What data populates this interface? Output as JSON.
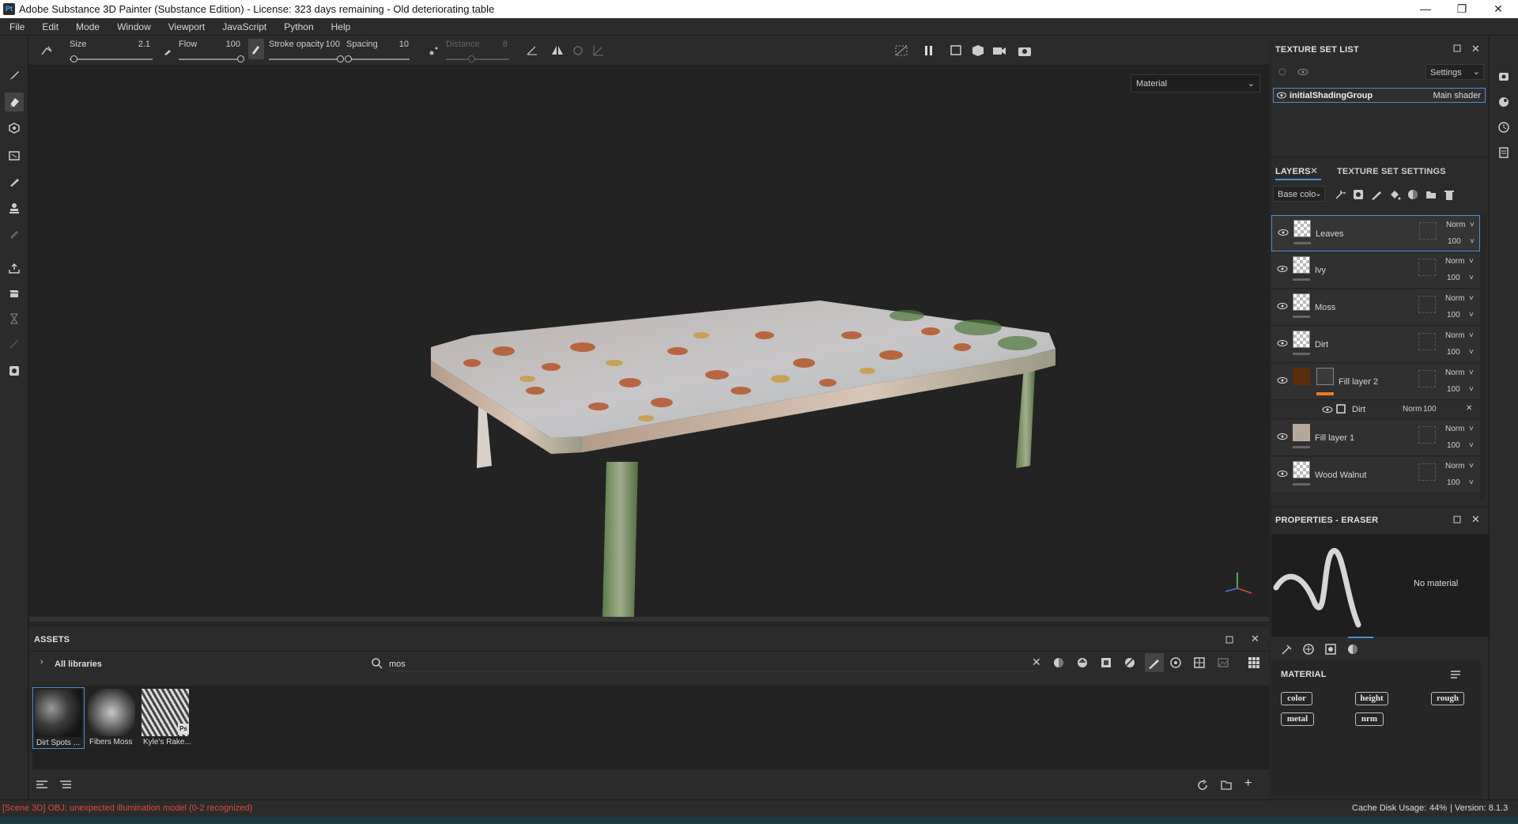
{
  "window": {
    "title": "Adobe Substance 3D Painter (Substance Edition) - License: 323 days remaining - Old deteriorating table",
    "app_icon": "Pt",
    "controls": [
      "minimize",
      "maximize",
      "close"
    ]
  },
  "menu": [
    "File",
    "Edit",
    "Mode",
    "Window",
    "Viewport",
    "JavaScript",
    "Python",
    "Help"
  ],
  "toolbar": {
    "size_label": "Size",
    "size_value": "2.1",
    "flow_label": "Flow",
    "flow_value": "100",
    "stroke_label": "Stroke opacity",
    "stroke_value": "100",
    "spacing_label": "Spacing",
    "spacing_value": "10",
    "distance_label": "Distance",
    "distance_value": "8",
    "size_level": 0.05,
    "flow_level": 1.0,
    "stroke_level": 1.0,
    "spacing_level": 0.02,
    "distance_level": 0.4
  },
  "viewport": {
    "display_mode": "Material"
  },
  "texture_set_list": {
    "title": "TEXTURE SET LIST",
    "settings_label": "Settings",
    "item_name": "initialShadingGroup",
    "item_shader": "Main shader"
  },
  "layers_panel": {
    "tab_layers": "LAYERS",
    "tab_tss": "TEXTURE SET SETTINGS",
    "channel": "Base colo",
    "layers": [
      {
        "name": "Leaves",
        "blend": "Norm",
        "opacity": "100"
      },
      {
        "name": "Ivy",
        "blend": "Norm",
        "opacity": "100"
      },
      {
        "name": "Moss",
        "blend": "Norm",
        "opacity": "100"
      },
      {
        "name": "Dirt",
        "blend": "Norm",
        "opacity": "100"
      },
      {
        "name": "Fill layer 2",
        "blend": "Norm",
        "opacity": "100"
      },
      {
        "name": "Fill layer 1",
        "blend": "Norm",
        "opacity": "100"
      },
      {
        "name": "Wood Walnut",
        "blend": "Norm",
        "opacity": "100"
      }
    ],
    "sub_effect": {
      "name": "Dirt",
      "blend": "Norm",
      "opacity": "100"
    },
    "colors": {
      "fill2_swatch": "#5a2d0c",
      "fill2_bar": "#e87a2a",
      "fill1_swatch": "#b5a89a"
    }
  },
  "properties": {
    "title": "PROPERTIES - ERASER",
    "no_material": "No material",
    "material_header": "MATERIAL",
    "chips": [
      "color",
      "height",
      "rough",
      "metal",
      "nrm"
    ]
  },
  "assets": {
    "title": "ASSETS",
    "breadcrumb": "All libraries",
    "search_value": "mos",
    "items": [
      {
        "label": "Dirt Spots ..."
      },
      {
        "label": "Fibers Moss"
      },
      {
        "label": "Kyle's Rake..."
      }
    ],
    "badge": "Ps"
  },
  "status": {
    "error": "[Scene 3D] OBJ: unexpected illumination model (0-2 recognized)",
    "cache_label": "Cache Disk Usage:",
    "cache_value": "44%",
    "version": "| Version: 8.1.3"
  },
  "accent": "#4a8fd8"
}
